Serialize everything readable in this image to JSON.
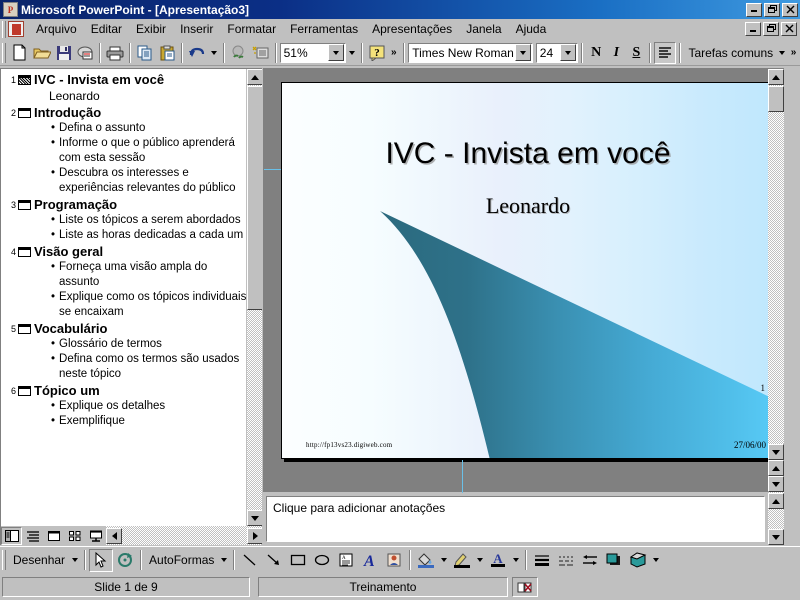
{
  "window": {
    "title": "Microsoft PowerPoint - [Apresentação3]",
    "app_icon": "powerpoint-icon",
    "minimize": "_",
    "restore": "❐",
    "close": "✕"
  },
  "menu": {
    "items": [
      {
        "label": "Arquivo",
        "accel": "A"
      },
      {
        "label": "Editar",
        "accel": "E"
      },
      {
        "label": "Exibir",
        "accel": "x"
      },
      {
        "label": "Inserir",
        "accel": "I"
      },
      {
        "label": "Formatar",
        "accel": "F"
      },
      {
        "label": "Ferramentas",
        "accel": "m"
      },
      {
        "label": "Apresentações",
        "accel": "t"
      },
      {
        "label": "Janela",
        "accel": "J"
      },
      {
        "label": "Ajuda",
        "accel": "u"
      }
    ]
  },
  "toolbar": {
    "buttons": [
      "new-icon",
      "open-icon",
      "save-icon",
      "email-icon",
      "print-icon",
      "copy-icon",
      "paste-icon",
      "undo-icon",
      "hyperlink-icon",
      "web-toolbar-icon"
    ],
    "zoom_value": "51%",
    "help_icon": "help-icon",
    "overflow": "»",
    "font_name": "Times New Roman",
    "font_size": "24",
    "bold_label": "N",
    "italic_label": "I",
    "underline_label": "S",
    "align_icon": "align-left-icon",
    "common_tasks": "Tarefas comuns"
  },
  "outline": {
    "slides": [
      {
        "number": "1",
        "icon": "slide-thumbnail-icon",
        "title": "IVC - Invista em você",
        "subtitle": "Leonardo",
        "bullets": []
      },
      {
        "number": "2",
        "icon": "slide-icon",
        "title": "Introdução",
        "bullets": [
          "Defina o assunto",
          "Informe o que o público aprenderá com esta sessão",
          "Descubra os interesses e experiências relevantes do público"
        ]
      },
      {
        "number": "3",
        "icon": "slide-icon",
        "title": "Programação",
        "bullets": [
          "Liste os tópicos a serem abordados",
          "Liste as horas dedicadas a cada um"
        ]
      },
      {
        "number": "4",
        "icon": "slide-icon",
        "title": "Visão geral",
        "bullets": [
          "Forneça uma visão ampla do assunto",
          "Explique como os tópicos individuais se encaixam"
        ]
      },
      {
        "number": "5",
        "icon": "slide-icon",
        "title": "Vocabulário",
        "bullets": [
          "Glossário de termos",
          "Defina como os termos são usados neste tópico"
        ]
      },
      {
        "number": "6",
        "icon": "slide-icon",
        "title": "Tópico um",
        "bullets": [
          "Explique os detalhes",
          "Exemplifique"
        ]
      }
    ],
    "view_buttons": [
      "normal-view-icon",
      "outline-view-icon",
      "slide-view-icon",
      "slide-sorter-view-icon",
      "slide-show-icon"
    ]
  },
  "slide": {
    "title": "IVC - Invista em você",
    "subtitle": "Leonardo",
    "url": "http://fp13vs23.digiweb.com",
    "page_number": "1",
    "date": "27/06/00",
    "bg_start": "#fcfeff",
    "bg_end": "#bfe7fd",
    "swoosh_dark": "#2d6c80",
    "swoosh_light": "#56c8f5"
  },
  "notes": {
    "placeholder": "Clique para adicionar anotações"
  },
  "drawing_toolbar": {
    "draw_menu": "Desenhar",
    "autoshapes_menu": "AutoFormas",
    "tools": [
      "select-arrow-icon",
      "free-rotate-icon",
      "line-icon",
      "arrow-icon",
      "rectangle-icon",
      "oval-icon",
      "text-box-icon",
      "wordart-icon",
      "clip-art-icon",
      "fill-color-icon",
      "line-color-icon",
      "font-color-icon",
      "line-style-icon",
      "dash-style-icon",
      "arrow-style-icon",
      "shadow-icon",
      "three-d-icon"
    ]
  },
  "status": {
    "slide_info": "Slide 1 de 9",
    "design_template": "Treinamento",
    "spell_icon": "spell-check-icon"
  }
}
